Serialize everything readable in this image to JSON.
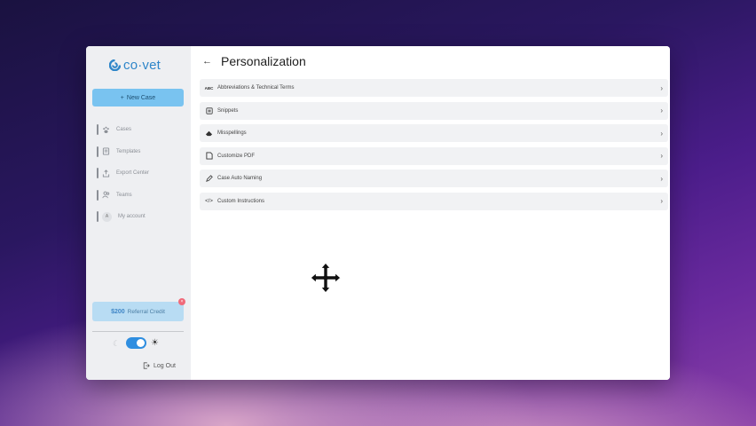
{
  "app": {
    "logo_text": "co·vet",
    "brand_color": "#2f86c9"
  },
  "sidebar": {
    "new_case_label": "New Case",
    "items": [
      {
        "label": "Cases",
        "icon": "paw-icon"
      },
      {
        "label": "Templates",
        "icon": "template-icon"
      },
      {
        "label": "Export Center",
        "icon": "export-icon"
      },
      {
        "label": "Teams",
        "icon": "team-icon"
      },
      {
        "label": "My account",
        "icon": "avatar",
        "avatar_letter": "A"
      }
    ],
    "referral": {
      "amount": "$200",
      "label": "Referral Credit",
      "badge": "×"
    },
    "logout_label": "Log Out"
  },
  "header": {
    "title": "Personalization"
  },
  "settings": [
    {
      "label": "Abbreviations & Technical Terms",
      "icon": "abc-icon"
    },
    {
      "label": "Snippets",
      "icon": "snippet-icon"
    },
    {
      "label": "Misspellings",
      "icon": "eraser-icon"
    },
    {
      "label": "Customize PDF",
      "icon": "pdf-icon"
    },
    {
      "label": "Case Auto Naming",
      "icon": "pencil-icon"
    },
    {
      "label": "Custom Instructions",
      "icon": "code-icon"
    }
  ],
  "colors": {
    "accent": "#79c3f0",
    "toggle_on": "#2f8ee0"
  }
}
